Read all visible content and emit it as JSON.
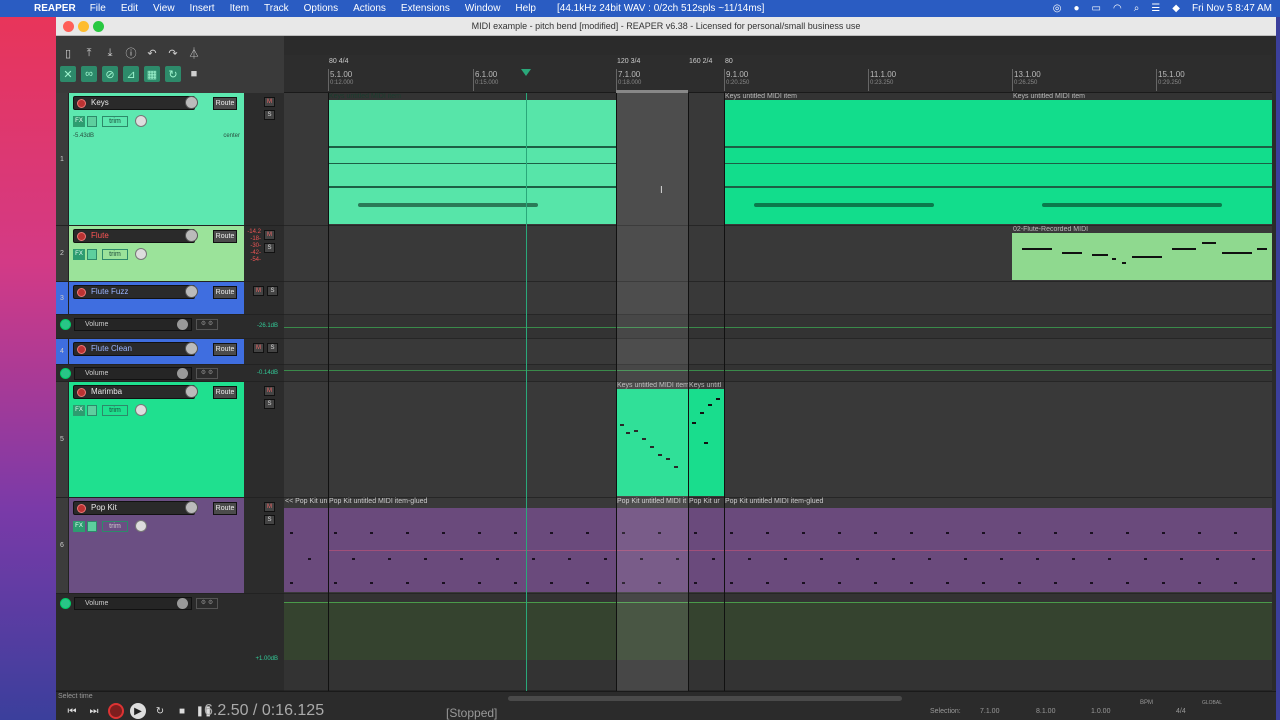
{
  "menubar": {
    "app": "REAPER",
    "items": [
      "File",
      "Edit",
      "View",
      "Insert",
      "Item",
      "Track",
      "Options",
      "Actions",
      "Extensions",
      "Window",
      "Help"
    ],
    "status": "[44.1kHz 24bit WAV : 0/2ch 512spls ~11/14ms]",
    "clock": "Fri Nov 5  8:47 AM"
  },
  "window": {
    "title": "MIDI example - pitch bend [modified] - REAPER v6.38 - Licensed for personal/small business use"
  },
  "tracks": [
    {
      "num": "1",
      "name": "Keys",
      "route": "Route",
      "fx": "FX",
      "trim": "trim",
      "volume": "-5.43dB",
      "pan": "center",
      "mute": "M",
      "solo": "S",
      "color": "#5de8b0"
    },
    {
      "num": "2",
      "name": "Flute",
      "route": "Route",
      "fx": "FX",
      "trim": "trim",
      "mute": "M",
      "solo": "S",
      "meter": [
        "-14.2",
        "-18-",
        "-30-",
        "-42-",
        "-54-"
      ],
      "color": "#9be39a"
    },
    {
      "num": "3",
      "name": "Flute Fuzz",
      "route": "Route",
      "mute": "M",
      "solo": "S",
      "color": "#3f6ee0"
    },
    {
      "num": "4",
      "name": "Flute Clean",
      "route": "Route",
      "mute": "M",
      "solo": "S",
      "color": "#3f6ee0"
    },
    {
      "num": "5",
      "name": "Marimba",
      "route": "Route",
      "fx": "FX",
      "trim": "trim",
      "mute": "M",
      "solo": "S",
      "color": "#1fe08f"
    },
    {
      "num": "6",
      "name": "Pop Kit",
      "route": "Route",
      "fx": "FX",
      "trim": "trim",
      "mute": "M",
      "solo": "S",
      "color": "#6b4f83"
    }
  ],
  "envelopes": [
    {
      "name": "Volume",
      "value": "-26.1dB"
    },
    {
      "name": "Volume",
      "value": "-0.14dB"
    },
    {
      "name": "Volume",
      "value": "+1.00dB"
    }
  ],
  "ruler": {
    "markers": [
      "80 4/4",
      "120 3/4",
      "160 2/4",
      "80"
    ],
    "measures": [
      "5.1.00",
      "6.1.00",
      "7.1.00",
      "9.1.00",
      "11.1.00",
      "13.1.00",
      "15.1.00"
    ],
    "times": [
      "0:12.000",
      "0:15.000",
      "0:18.000",
      "0:20.250",
      "0:23.250",
      "0:26.250",
      "0:29.250"
    ]
  },
  "items": {
    "keys_a": "Keys untitled MIDI item",
    "keys_b": "Keys untitled MIDI item",
    "keys_c": "Keys untitled MIDI item",
    "flute": "02-Flute-Recorded MIDI",
    "marimba_a": "Keys untitled MIDI item",
    "marimba_b": "Keys untitl",
    "pop_a": "<< Pop Kit un",
    "pop_b": "Pop Kit untitled MIDI item-glued",
    "pop_c": "Pop Kit untitled MIDI it",
    "pop_d": "Pop Kit ur",
    "pop_e": "Pop Kit untitled MIDI item-glued"
  },
  "transport": {
    "status_label": "Select time",
    "timecode": "6.2.50 / 0:16.125",
    "state": "[Stopped]",
    "selection_label": "Selection:",
    "sel_start": "7.1.00",
    "sel_end": "8.1.00",
    "sel_len": "1.0.00",
    "bpm_label": "BPM",
    "time_sig": "4/4",
    "global": "GLOBAL"
  }
}
